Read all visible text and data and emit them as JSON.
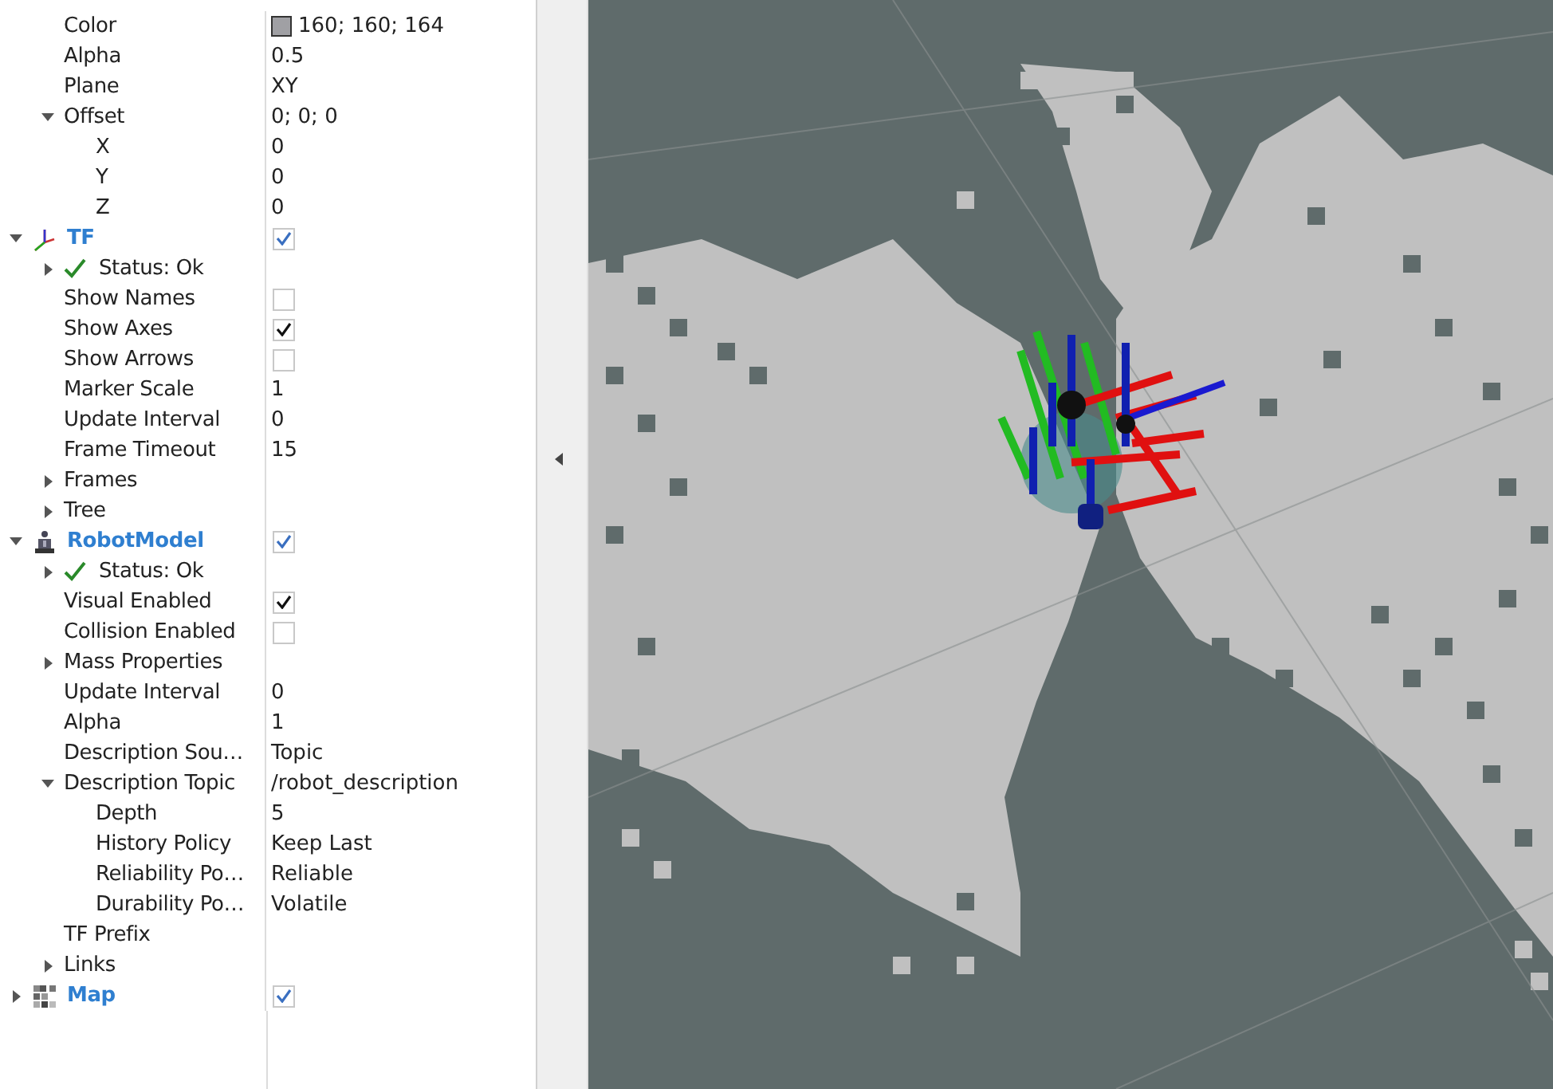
{
  "grid_properties": [
    {
      "kind": "color",
      "label": "Color",
      "value": "160; 160; 164",
      "color": "#a0a0a4"
    },
    {
      "kind": "property",
      "label": "Alpha",
      "value": "0.5"
    },
    {
      "kind": "property",
      "label": "Plane",
      "value": "XY"
    },
    {
      "kind": "property",
      "label": "Offset",
      "value": "0; 0; 0",
      "expanded": true,
      "children": [
        {
          "kind": "property",
          "label": "X",
          "value": "0"
        },
        {
          "kind": "property",
          "label": "Y",
          "value": "0"
        },
        {
          "kind": "property",
          "label": "Z",
          "value": "0"
        }
      ]
    }
  ],
  "displays": [
    {
      "kind": "tf",
      "label": "TF",
      "checked": true,
      "expanded": true,
      "children": [
        {
          "kind": "status",
          "label": "Status: Ok",
          "expanded": false
        },
        {
          "kind": "property",
          "label": "Show Names",
          "checked": false
        },
        {
          "kind": "property",
          "label": "Show Axes",
          "checked": true
        },
        {
          "kind": "property",
          "label": "Show Arrows",
          "checked": false
        },
        {
          "kind": "property",
          "label": "Marker Scale",
          "value": "1"
        },
        {
          "kind": "property",
          "label": "Update Interval",
          "value": "0"
        },
        {
          "kind": "property",
          "label": "Frame Timeout",
          "value": "15"
        },
        {
          "kind": "property",
          "label": "Frames",
          "expanded": false
        },
        {
          "kind": "property",
          "label": "Tree",
          "expanded": false
        }
      ]
    },
    {
      "kind": "robot",
      "label": "RobotModel",
      "checked": true,
      "expanded": true,
      "children": [
        {
          "kind": "status",
          "label": "Status: Ok",
          "expanded": false
        },
        {
          "kind": "property",
          "label": "Visual Enabled",
          "checked": true
        },
        {
          "kind": "property",
          "label": "Collision Enabled",
          "checked": false
        },
        {
          "kind": "property",
          "label": "Mass Properties",
          "expanded": false
        },
        {
          "kind": "property",
          "label": "Update Interval",
          "value": "0"
        },
        {
          "kind": "property",
          "label": "Alpha",
          "value": "1"
        },
        {
          "kind": "property",
          "label": "Description Sou…",
          "value": "Topic"
        },
        {
          "kind": "property",
          "label": "Description Topic",
          "value": "/robot_description",
          "expanded": true,
          "children": [
            {
              "kind": "property",
              "label": "Depth",
              "value": "5"
            },
            {
              "kind": "property",
              "label": "History Policy",
              "value": "Keep Last"
            },
            {
              "kind": "property",
              "label": "Reliability Po…",
              "value": "Reliable"
            },
            {
              "kind": "property",
              "label": "Durability Po…",
              "value": "Volatile"
            }
          ]
        },
        {
          "kind": "property",
          "label": "TF Prefix"
        },
        {
          "kind": "property",
          "label": "Links",
          "expanded": false
        }
      ]
    },
    {
      "kind": "map",
      "label": "Map",
      "checked": true,
      "expanded": false
    }
  ]
}
